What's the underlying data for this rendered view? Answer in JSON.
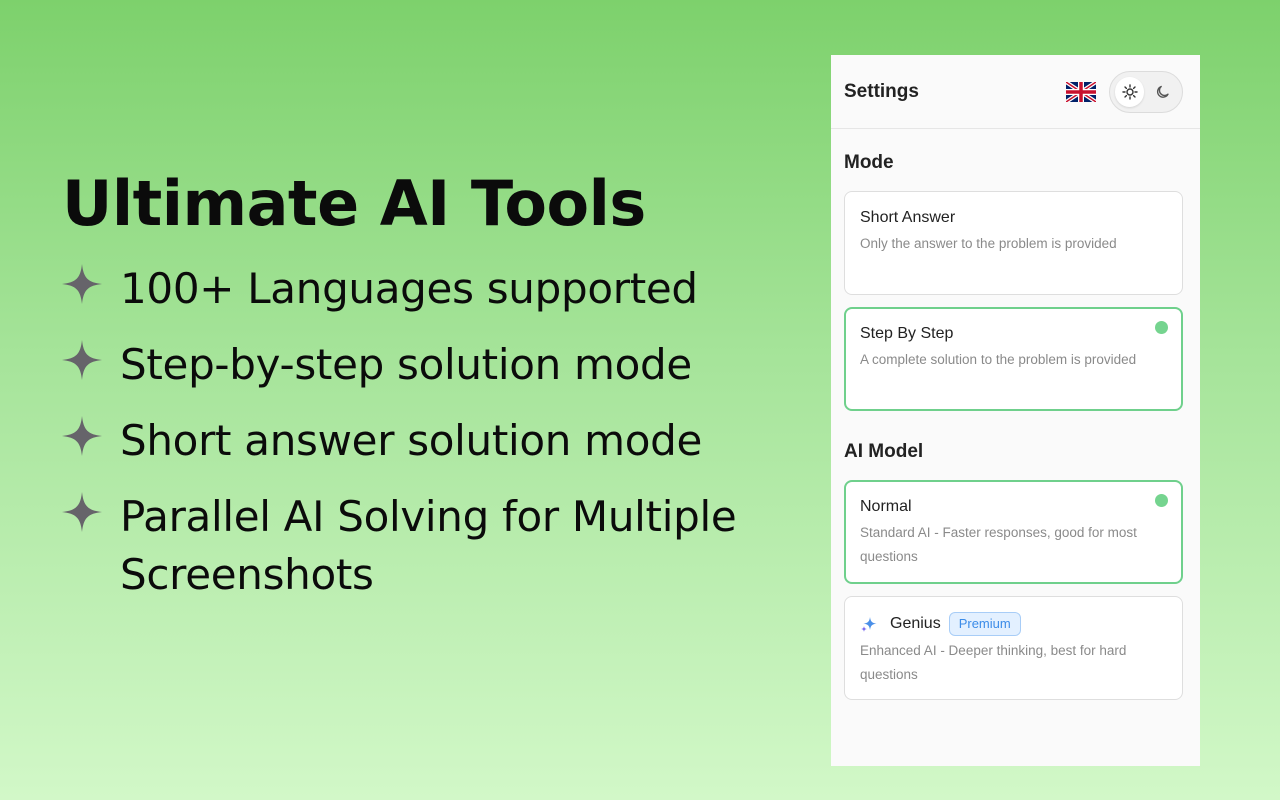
{
  "hero": {
    "title": "Ultimate AI Tools",
    "features": [
      "100+ Languages supported",
      "Step-by-step solution mode",
      "Short answer solution mode",
      "Parallel AI Solving for Multiple Screenshots"
    ],
    "bullet_icon": "four-point-star-icon",
    "bullet_color": "#66646a"
  },
  "panel": {
    "title": "Settings",
    "language_icon": "uk-flag-icon",
    "theme_options": [
      "sun-icon",
      "moon-icon"
    ],
    "mode": {
      "title": "Mode",
      "options": [
        {
          "title": "Short Answer",
          "desc": "Only the answer to the problem is provided",
          "selected": false
        },
        {
          "title": "Step By Step",
          "desc": "A complete solution to the problem is provided",
          "selected": true
        }
      ]
    },
    "model": {
      "title": "AI Model",
      "options": [
        {
          "title": "Normal",
          "desc": "Standard AI - Faster responses, good for most questions",
          "selected": true
        },
        {
          "title": "Genius",
          "badge": "Premium",
          "icon": "sparkle-icon",
          "desc": "Enhanced AI - Deeper thinking, best for hard questions",
          "selected": false
        }
      ]
    }
  },
  "colors": {
    "accent_green": "#75d48f",
    "premium_blue": "#3c8ce8"
  }
}
